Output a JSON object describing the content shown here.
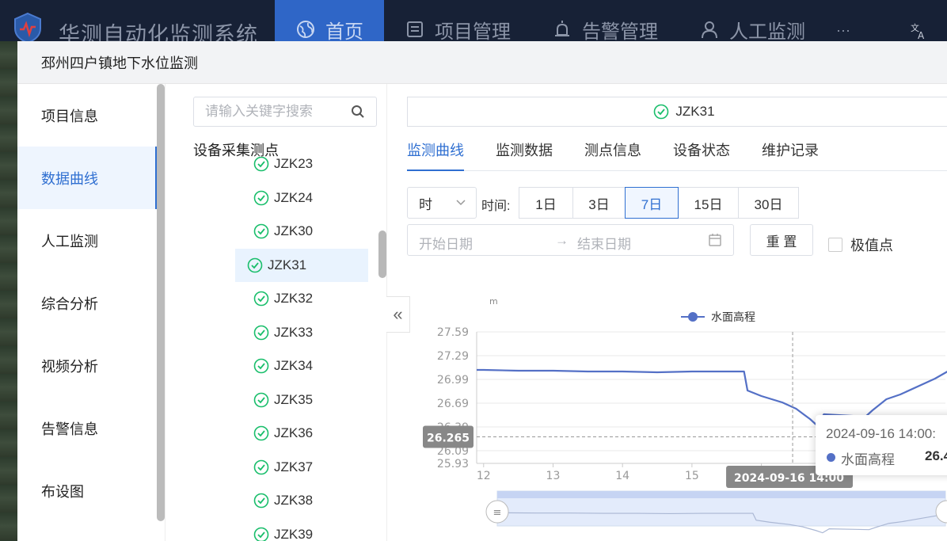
{
  "app": {
    "title": "华测自动化监测系统"
  },
  "nav": [
    {
      "label": "首页",
      "icon": "globe-icon",
      "active": true
    },
    {
      "label": "项目管理",
      "icon": "document-icon",
      "active": false
    },
    {
      "label": "告警管理",
      "icon": "alarm-icon",
      "active": false
    },
    {
      "label": "人工监测",
      "icon": "worker-icon",
      "active": false
    }
  ],
  "nav_more": "···",
  "modal": {
    "title": "邳州四户镇地下水位监测"
  },
  "menu": [
    {
      "label": "项目信息",
      "active": false
    },
    {
      "label": "数据曲线",
      "active": true
    },
    {
      "label": "人工监测",
      "active": false
    },
    {
      "label": "综合分析",
      "active": false
    },
    {
      "label": "视频分析",
      "active": false
    },
    {
      "label": "告警信息",
      "active": false
    },
    {
      "label": "布设图",
      "active": false
    }
  ],
  "search": {
    "placeholder": "请输入关键字搜索"
  },
  "tree": {
    "title": "设备采集测点",
    "items": [
      "JZK23",
      "JZK24",
      "JZK30",
      "JZK31",
      "JZK32",
      "JZK33",
      "JZK34",
      "JZK35",
      "JZK36",
      "JZK37",
      "JZK38",
      "JZK39"
    ],
    "selected": "JZK31"
  },
  "collapse_label": "«",
  "point": {
    "name": "JZK31"
  },
  "tabs": [
    {
      "label": "监测曲线",
      "active": true
    },
    {
      "label": "监测数据",
      "active": false
    },
    {
      "label": "测点信息",
      "active": false
    },
    {
      "label": "设备状态",
      "active": false
    },
    {
      "label": "维护记录",
      "active": false
    }
  ],
  "filters": {
    "granularity": "时",
    "time_label": "时间:",
    "ranges": [
      "1日",
      "3日",
      "7日",
      "15日",
      "30日"
    ],
    "active_range": "7日",
    "start_placeholder": "开始日期",
    "range_sep": "→",
    "end_placeholder": "结束日期",
    "reset_label": "重 置",
    "extreme_label": "极值点"
  },
  "colors": {
    "accent": "#2f6fd1",
    "series": "#5470c6",
    "topbar": "#172136",
    "nav_active": "#2f66c7",
    "ok_green": "#19be6b"
  },
  "chart_data": {
    "type": "line",
    "unit": "m",
    "legend": "水面高程",
    "series": [
      {
        "name": "水面高程",
        "x": [
          11.9,
          12.0,
          12.5,
          13.0,
          13.5,
          14.0,
          14.5,
          15.0,
          15.5,
          15.75,
          15.8,
          16.0,
          16.3,
          16.5,
          16.7,
          16.8,
          16.9,
          17.3,
          17.5,
          17.6,
          17.8,
          18.0,
          18.5,
          18.7
        ],
        "y": [
          27.11,
          27.11,
          27.1,
          27.1,
          27.09,
          27.09,
          27.08,
          27.09,
          27.09,
          27.09,
          26.85,
          26.78,
          26.7,
          26.62,
          26.49,
          26.41,
          26.55,
          26.53,
          26.52,
          26.6,
          26.74,
          26.8,
          27.0,
          27.1
        ]
      }
    ],
    "yticks": [
      "27.59",
      "27.29",
      "26.99",
      "26.69",
      "26.39",
      "26.09",
      "25.93"
    ],
    "xticks": [
      "12",
      "13",
      "14",
      "15",
      "16"
    ],
    "ylim": [
      25.93,
      27.59
    ],
    "crosshair": {
      "x_label": "2024-09-16 14:00",
      "y_label": "26.265",
      "x": 16.45,
      "y": 26.265
    }
  },
  "tooltip": {
    "title": "2024-09-16 14:00:",
    "series": "水面高程",
    "value": "26.4"
  }
}
